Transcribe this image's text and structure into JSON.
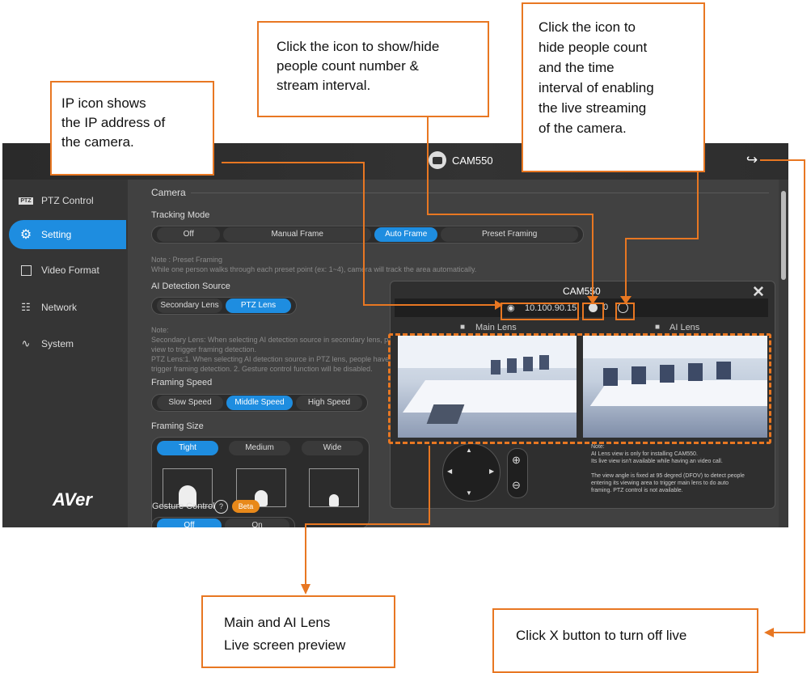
{
  "window": {
    "camera_name": "CAM550",
    "logout_icon": "logout-icon"
  },
  "sidebar": {
    "items": [
      {
        "label": "PTZ Control",
        "icon": "ptz-icon"
      },
      {
        "label": "Setting",
        "icon": "gear-icon"
      },
      {
        "label": "Video Format",
        "icon": "film-icon"
      },
      {
        "label": "Network",
        "icon": "network-icon"
      },
      {
        "label": "System",
        "icon": "pulse-icon"
      }
    ],
    "brand": "AVer"
  },
  "settings": {
    "section_title": "Camera",
    "tracking_mode": {
      "label": "Tracking Mode",
      "options": [
        "Off",
        "Manual Frame",
        "Auto Frame",
        "Preset Framing"
      ],
      "selected": "Auto Frame"
    },
    "preset_note": [
      "Note : Preset Framing",
      "While one person walks through each preset point (ex: 1~4), camera will track the area automatically."
    ],
    "ai_source": {
      "label": "AI Detection Source",
      "options": [
        "Secondary Lens",
        "PTZ Lens"
      ],
      "selected": "PTZ Lens"
    },
    "ai_note": [
      "Note:",
      "Secondary Lens: When selecting AI detection source in secondary lens, p",
      "view to trigger framing detection.",
      "PTZ Lens:1. When selecting AI detection source in PTZ lens, people have",
      "trigger framing detection. 2. Gesture control function will be disabled."
    ],
    "framing_speed": {
      "label": "Framing Speed",
      "options": [
        "Slow Speed",
        "Middle Speed",
        "High Speed"
      ],
      "selected": "Middle Speed"
    },
    "framing_size": {
      "label": "Framing Size",
      "options": [
        "Tight",
        "Medium",
        "Wide"
      ],
      "selected": "Tight"
    },
    "gesture": {
      "label": "Gesture Control",
      "badge": "Beta",
      "options": [
        "Off",
        "On"
      ],
      "selected": "Off"
    }
  },
  "popup": {
    "title": "CAM550",
    "ip": "10.100.90.15",
    "people_count": "0",
    "main_lens_label": "Main Lens",
    "ai_lens_label": "AI Lens",
    "note": [
      "Note:",
      "AI Lens view is only for installing CAM550.",
      "Its live view isn't available while having an video call.",
      "",
      "The view angle is fixed at 95 degred (DFOV) to detect people",
      "entering its viewing area to trigger main lens to do auto",
      "framing. PTZ control is not available."
    ]
  },
  "callouts": {
    "ip": [
      "IP icon shows",
      "the IP address of",
      "the camera."
    ],
    "show_hide": [
      "Click the icon to show/hide",
      "people count number &",
      "stream interval."
    ],
    "hide_count": [
      "Click the icon to",
      "hide people count",
      "and the time",
      "interval of enabling",
      "the live streaming",
      "of the camera."
    ],
    "preview": [
      "Main and AI Lens",
      "Live screen preview"
    ],
    "close": [
      "Click X button to turn off live"
    ]
  },
  "colors": {
    "accent_blue": "#1e8de0",
    "annotation_orange": "#e87722",
    "beta_badge": "#e8891a"
  }
}
